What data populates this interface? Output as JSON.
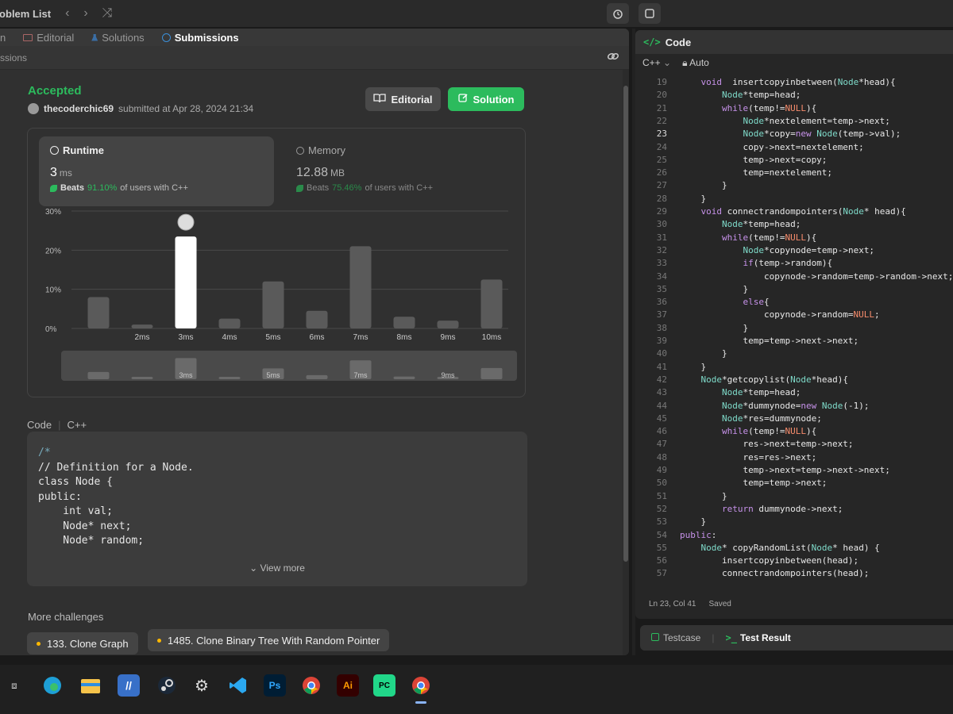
{
  "topbar": {
    "title": "roblem List",
    "prev_icon": "‹",
    "next_icon": "›",
    "shuffle_icon": "⤨"
  },
  "tabs": [
    {
      "label": "n"
    },
    {
      "label": "Editorial"
    },
    {
      "label": "Solutions"
    },
    {
      "label": "Submissions"
    }
  ],
  "subheader": {
    "label": "ssions"
  },
  "submission": {
    "status": "Accepted",
    "user": "thecoderchic69",
    "submitted_text": "submitted at Apr 28, 2024 21:34",
    "editorial_label": "Editorial",
    "solution_label": "Solution"
  },
  "runtime": {
    "label": "Runtime",
    "value": "3",
    "unit": "ms",
    "beats_prefix": "Beats",
    "beats_pct": "91.10%",
    "beats_suffix": "of users with C++"
  },
  "memory": {
    "label": "Memory",
    "value": "12.88",
    "unit": "MB",
    "beats_prefix": "Beats",
    "beats_pct": "75.46%",
    "beats_suffix": "of users with C++"
  },
  "chart_data": {
    "type": "bar",
    "categories": [
      "",
      "2ms",
      "3ms",
      "4ms",
      "5ms",
      "6ms",
      "7ms",
      "8ms",
      "9ms",
      "10ms"
    ],
    "values": [
      8,
      1,
      23.5,
      2.5,
      12,
      4.5,
      21,
      3,
      2,
      12.5
    ],
    "highlight_index": 2,
    "ylim": [
      0,
      30
    ],
    "yticks": [
      "30%",
      "20%",
      "10%",
      "0%"
    ],
    "overview_labels": [
      "3ms",
      "5ms",
      "7ms",
      "9ms"
    ],
    "grid": true
  },
  "code_section": {
    "label": "Code",
    "lang": "C++",
    "lines": [
      "/*",
      "// Definition for a Node.",
      "class Node {",
      "public:",
      "    int val;",
      "    Node* next;",
      "    Node* random;"
    ],
    "view_more": "View more"
  },
  "more_challenges": {
    "label": "More challenges",
    "items": [
      "133. Clone Graph",
      "1485. Clone Binary Tree With Random Pointer"
    ]
  },
  "editor": {
    "title": "Code",
    "language": "C++",
    "mode": "Auto",
    "status_pos": "Ln 23, Col 41",
    "status_saved": "Saved",
    "current_line": 23,
    "lines": [
      {
        "n": 19,
        "t": "    void  insertcopyinbetween(Node*head){"
      },
      {
        "n": 20,
        "t": "        Node*temp=head;"
      },
      {
        "n": 21,
        "t": "        while(temp!=NULL){"
      },
      {
        "n": 22,
        "t": "            Node*nextelement=temp->next;"
      },
      {
        "n": 23,
        "t": "            Node*copy=new Node(temp->val);"
      },
      {
        "n": 24,
        "t": "            copy->next=nextelement;"
      },
      {
        "n": 25,
        "t": "            temp->next=copy;"
      },
      {
        "n": 26,
        "t": "            temp=nextelement;"
      },
      {
        "n": 27,
        "t": "        }"
      },
      {
        "n": 28,
        "t": "    }"
      },
      {
        "n": 29,
        "t": "    void connectrandompointers(Node* head){"
      },
      {
        "n": 30,
        "t": "        Node*temp=head;"
      },
      {
        "n": 31,
        "t": "        while(temp!=NULL){"
      },
      {
        "n": 32,
        "t": "            Node*copynode=temp->next;"
      },
      {
        "n": 33,
        "t": "            if(temp->random){"
      },
      {
        "n": 34,
        "t": "                copynode->random=temp->random->next;"
      },
      {
        "n": 35,
        "t": "            }"
      },
      {
        "n": 36,
        "t": "            else{"
      },
      {
        "n": 37,
        "t": "                copynode->random=NULL;"
      },
      {
        "n": 38,
        "t": "            }"
      },
      {
        "n": 39,
        "t": "            temp=temp->next->next;"
      },
      {
        "n": 40,
        "t": "        }"
      },
      {
        "n": 41,
        "t": "    }"
      },
      {
        "n": 42,
        "t": "    Node*getcopylist(Node*head){"
      },
      {
        "n": 43,
        "t": "        Node*temp=head;"
      },
      {
        "n": 44,
        "t": "        Node*dummynode=new Node(-1);"
      },
      {
        "n": 45,
        "t": "        Node*res=dummynode;"
      },
      {
        "n": 46,
        "t": "        while(temp!=NULL){"
      },
      {
        "n": 47,
        "t": "            res->next=temp->next;"
      },
      {
        "n": 48,
        "t": "            res=res->next;"
      },
      {
        "n": 49,
        "t": "            temp->next=temp->next->next;"
      },
      {
        "n": 50,
        "t": "            temp=temp->next;"
      },
      {
        "n": 51,
        "t": "        }"
      },
      {
        "n": 52,
        "t": "        return dummynode->next;"
      },
      {
        "n": 53,
        "t": "    }"
      },
      {
        "n": 54,
        "t": "public:"
      },
      {
        "n": 55,
        "t": "    Node* copyRandomList(Node* head) {"
      },
      {
        "n": 56,
        "t": "        insertcopyinbetween(head);"
      },
      {
        "n": 57,
        "t": "        connectrandompointers(head);"
      }
    ]
  },
  "bottom_panel": {
    "testcase": "Testcase",
    "test_result": "Test Result"
  },
  "taskbar": {
    "ps_label": "Ps",
    "ai_label": "Ai",
    "pc_label": "PC"
  },
  "colors": {
    "accent_green": "#2cbb5d",
    "background": "#303030",
    "editor_bg": "#262626"
  }
}
